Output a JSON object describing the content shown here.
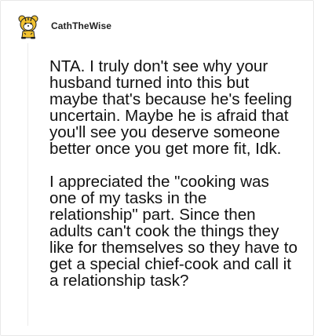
{
  "comment": {
    "username": "CathTheWise",
    "avatar_icon": "tiger-mascot-icon",
    "body": "NTA. I truly don't see why your husband turned into this but maybe that's because he's feeling uncertain. Maybe he is afraid that you'll see you deserve someone better once you get more fit, Idk.\n\nI appreciated the \"cooking was one of my tasks in the relationship\" part. Since then adults can't cook the things they like for themselves so they have to get a special chief-cook and call it a relationship task?"
  },
  "colors": {
    "avatar_primary": "#f2c230",
    "avatar_stripe": "#222222",
    "text": "#111111",
    "border": "#e8e8e8"
  }
}
